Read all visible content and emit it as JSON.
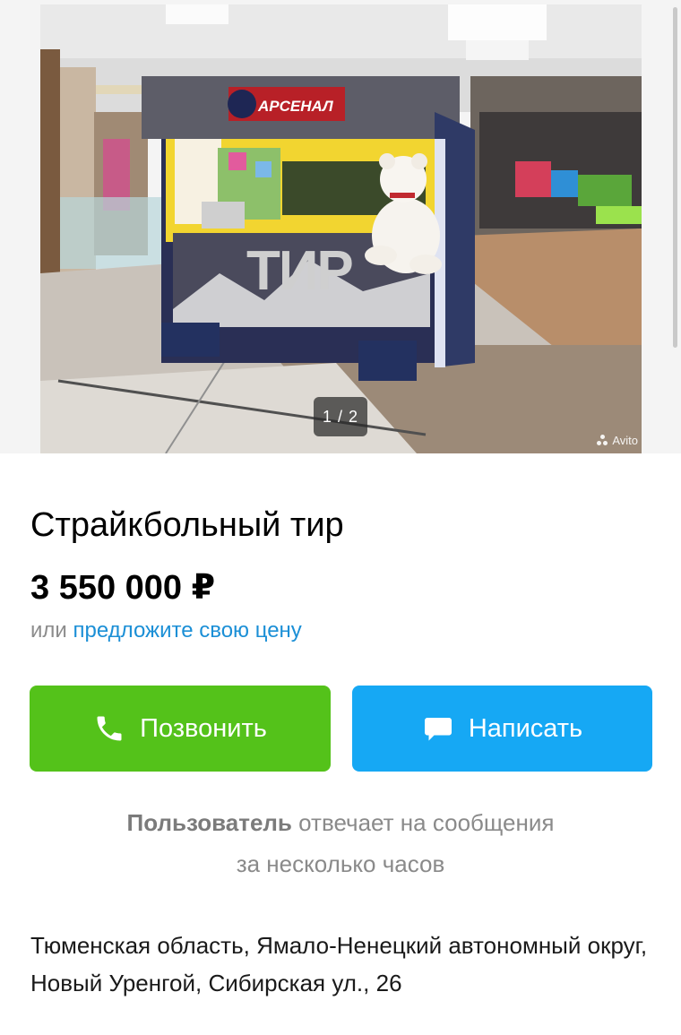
{
  "gallery": {
    "counter": "1 / 2",
    "watermark": "Avito",
    "photo_description_icon": "kiosk-photo",
    "sign_brand": "АРСЕНАЛ",
    "sign_main": "ТИР"
  },
  "listing": {
    "title": "Страйкбольный тир",
    "price": "3 550 000 ₽",
    "offer_prefix": "или",
    "offer_link": "предложите свою цену"
  },
  "actions": {
    "call_label": "Позвонить",
    "call_icon": "phone-icon",
    "write_label": "Написать",
    "write_icon": "chat-bubble-icon"
  },
  "seller": {
    "name": "Пользователь",
    "response_line1": "отвечает на сообщения",
    "response_line2": "за несколько часов"
  },
  "address": "Тюменская область, Ямало-Ненецкий автономный округ, Новый Уренгой, Сибирская ул., 26",
  "colors": {
    "call_button": "#54c21a",
    "write_button": "#16a8f4",
    "link": "#1b8fd6",
    "muted_text": "#8c8c8c"
  }
}
